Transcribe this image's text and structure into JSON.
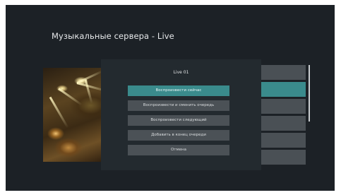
{
  "header": {
    "title": "Музыкальные сервера - Live"
  },
  "dialog": {
    "title": "Live 01",
    "options": [
      {
        "label": "Воспроизвести сейчас",
        "selected": true
      },
      {
        "label": "Воспроизвести и сменить очередь",
        "selected": false
      },
      {
        "label": "Воспроизвести следующий",
        "selected": false
      },
      {
        "label": "Добавить в конец очереди",
        "selected": false
      },
      {
        "label": "Отмена",
        "selected": false
      }
    ]
  },
  "colors": {
    "background": "#1c2126",
    "dialog": "#232a2f",
    "accent": "#3a8b8c",
    "option": "#4b5156"
  },
  "thumbnail": {
    "icon": "concert-image"
  }
}
